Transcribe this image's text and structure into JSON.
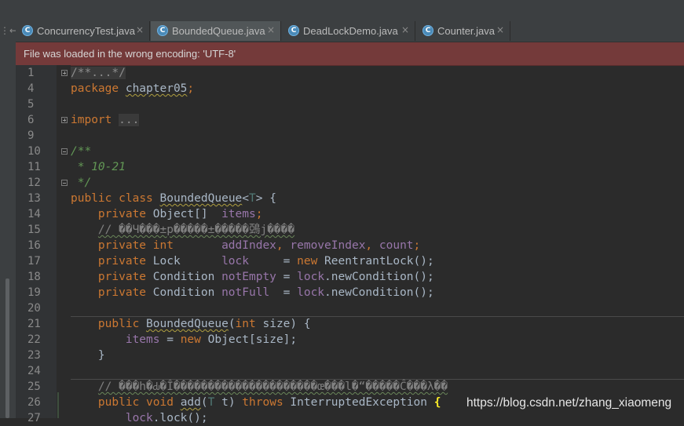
{
  "tab_bar": {
    "scroll_icon": "⋮←",
    "tabs": [
      {
        "label": "ConcurrencyTest.java",
        "icon": "java-class-icon",
        "icon_glyph": "C",
        "close": "×",
        "active": false
      },
      {
        "label": "BoundedQueue.java",
        "icon": "java-class-icon",
        "icon_glyph": "C",
        "close": "×",
        "active": true
      },
      {
        "label": "DeadLockDemo.java",
        "icon": "java-class-icon",
        "icon_glyph": "C",
        "close": "×",
        "active": false
      },
      {
        "label": "Counter.java",
        "icon": "java-class-icon",
        "icon_glyph": "C",
        "close": "×",
        "active": false
      }
    ]
  },
  "banner": {
    "text": "File was loaded in the wrong encoding: 'UTF-8'"
  },
  "colors": {
    "keyword": "#cc7832",
    "field": "#9876aa",
    "doc_comment": "#629755",
    "comment": "#808080",
    "text": "#a9b7c6",
    "banner_bg": "#743a3a",
    "brace_highlight": "#ffef28"
  },
  "editor": {
    "lines": [
      {
        "num": "1",
        "fold": "plus",
        "tokens": [
          {
            "t": "/**...*/",
            "c": "fold"
          }
        ]
      },
      {
        "num": "4",
        "tokens": [
          {
            "t": "package",
            "c": "kw"
          },
          {
            "t": " "
          },
          {
            "t": "chapter05",
            "c": "txt",
            "u": "warn"
          },
          {
            "t": ";",
            "c": "kw"
          }
        ]
      },
      {
        "num": "5",
        "tokens": []
      },
      {
        "num": "6",
        "fold": "plus",
        "tokens": [
          {
            "t": "import",
            "c": "kw"
          },
          {
            "t": " "
          },
          {
            "t": "...",
            "c": "fold"
          }
        ]
      },
      {
        "num": "9",
        "tokens": []
      },
      {
        "num": "10",
        "fold": "minus",
        "tokens": [
          {
            "t": "/**",
            "c": "doc"
          }
        ]
      },
      {
        "num": "11",
        "tokens": [
          {
            "t": " * 10-21",
            "c": "doc"
          }
        ]
      },
      {
        "num": "12",
        "fold": "minus",
        "tokens": [
          {
            "t": " */",
            "c": "doc"
          }
        ]
      },
      {
        "num": "13",
        "tokens": [
          {
            "t": "public",
            "c": "kw"
          },
          {
            "t": " "
          },
          {
            "t": "class",
            "c": "kw"
          },
          {
            "t": " "
          },
          {
            "t": "BoundedQueue",
            "c": "txt",
            "u": "warn"
          },
          {
            "t": "<",
            "c": "txt"
          },
          {
            "t": "T",
            "c": "tp"
          },
          {
            "t": "> {",
            "c": "txt"
          }
        ]
      },
      {
        "num": "14",
        "tokens": [
          {
            "t": "    "
          },
          {
            "t": "private",
            "c": "kw"
          },
          {
            "t": " "
          },
          {
            "t": "Object[]",
            "c": "txt"
          },
          {
            "t": "  "
          },
          {
            "t": "items",
            "c": "fld"
          },
          {
            "t": ";",
            "c": "kw"
          }
        ]
      },
      {
        "num": "15",
        "tokens": [
          {
            "t": "    "
          },
          {
            "t": "// ��Ч���±р�����±�����鵶j����",
            "c": "gar",
            "u": "ok"
          }
        ]
      },
      {
        "num": "16",
        "tokens": [
          {
            "t": "    "
          },
          {
            "t": "private",
            "c": "kw"
          },
          {
            "t": " "
          },
          {
            "t": "int",
            "c": "kw"
          },
          {
            "t": "       "
          },
          {
            "t": "addIndex",
            "c": "fld"
          },
          {
            "t": ", ",
            "c": "kw"
          },
          {
            "t": "removeIndex",
            "c": "fld"
          },
          {
            "t": ", ",
            "c": "kw"
          },
          {
            "t": "count",
            "c": "fld"
          },
          {
            "t": ";",
            "c": "kw"
          }
        ]
      },
      {
        "num": "17",
        "tokens": [
          {
            "t": "    "
          },
          {
            "t": "private",
            "c": "kw"
          },
          {
            "t": " "
          },
          {
            "t": "Lock",
            "c": "txt"
          },
          {
            "t": "      "
          },
          {
            "t": "lock",
            "c": "fld"
          },
          {
            "t": "     = ",
            "c": "txt"
          },
          {
            "t": "new",
            "c": "kw"
          },
          {
            "t": " "
          },
          {
            "t": "ReentrantLock();",
            "c": "txt"
          }
        ]
      },
      {
        "num": "18",
        "tokens": [
          {
            "t": "    "
          },
          {
            "t": "private",
            "c": "kw"
          },
          {
            "t": " "
          },
          {
            "t": "Condition",
            "c": "txt"
          },
          {
            "t": " "
          },
          {
            "t": "notEmpty",
            "c": "fld"
          },
          {
            "t": " = ",
            "c": "txt"
          },
          {
            "t": "lock",
            "c": "fld"
          },
          {
            "t": ".newCondition();",
            "c": "txt"
          }
        ]
      },
      {
        "num": "19",
        "tokens": [
          {
            "t": "    "
          },
          {
            "t": "private",
            "c": "kw"
          },
          {
            "t": " "
          },
          {
            "t": "Condition",
            "c": "txt"
          },
          {
            "t": " "
          },
          {
            "t": "notFull",
            "c": "fld"
          },
          {
            "t": "  = ",
            "c": "txt"
          },
          {
            "t": "lock",
            "c": "fld"
          },
          {
            "t": ".newCondition();",
            "c": "txt"
          }
        ]
      },
      {
        "num": "20",
        "tokens": []
      },
      {
        "num": "21",
        "sep": true,
        "tokens": [
          {
            "t": "    "
          },
          {
            "t": "public",
            "c": "kw"
          },
          {
            "t": " "
          },
          {
            "t": "BoundedQueue",
            "c": "txt",
            "u": "warn"
          },
          {
            "t": "(",
            "c": "txt"
          },
          {
            "t": "int",
            "c": "kw"
          },
          {
            "t": " size) {",
            "c": "txt"
          }
        ]
      },
      {
        "num": "22",
        "tokens": [
          {
            "t": "        "
          },
          {
            "t": "items",
            "c": "fld"
          },
          {
            "t": " = ",
            "c": "txt"
          },
          {
            "t": "new",
            "c": "kw"
          },
          {
            "t": " "
          },
          {
            "t": "Object[size];",
            "c": "txt"
          }
        ]
      },
      {
        "num": "23",
        "tokens": [
          {
            "t": "    }",
            "c": "txt"
          }
        ]
      },
      {
        "num": "24",
        "tokens": []
      },
      {
        "num": "25",
        "sep": true,
        "tokens": [
          {
            "t": "    "
          },
          {
            "t": "// ���һ�Ԃ�Î���������������������œ���l�“�����Ĉ���λ��",
            "c": "gar",
            "u": "ok"
          }
        ]
      },
      {
        "num": "26",
        "tokens": [
          {
            "t": "    "
          },
          {
            "t": "public",
            "c": "kw"
          },
          {
            "t": " "
          },
          {
            "t": "void",
            "c": "kw"
          },
          {
            "t": " "
          },
          {
            "t": "add",
            "c": "txt",
            "u": "warn"
          },
          {
            "t": "(",
            "c": "txt"
          },
          {
            "t": "T",
            "c": "tp"
          },
          {
            "t": " t) ",
            "c": "txt"
          },
          {
            "t": "throws",
            "c": "kw"
          },
          {
            "t": " "
          },
          {
            "t": "InterruptedException",
            "c": "txt"
          },
          {
            "t": " "
          },
          {
            "t": "{",
            "c": "brace"
          }
        ]
      },
      {
        "num": "27",
        "tokens": [
          {
            "t": "        "
          },
          {
            "t": "lock",
            "c": "fld"
          },
          {
            "t": ".lock();",
            "c": "txt"
          }
        ]
      }
    ]
  },
  "watermark": {
    "text": "https://blog.csdn.net/zhang_xiaomeng"
  }
}
